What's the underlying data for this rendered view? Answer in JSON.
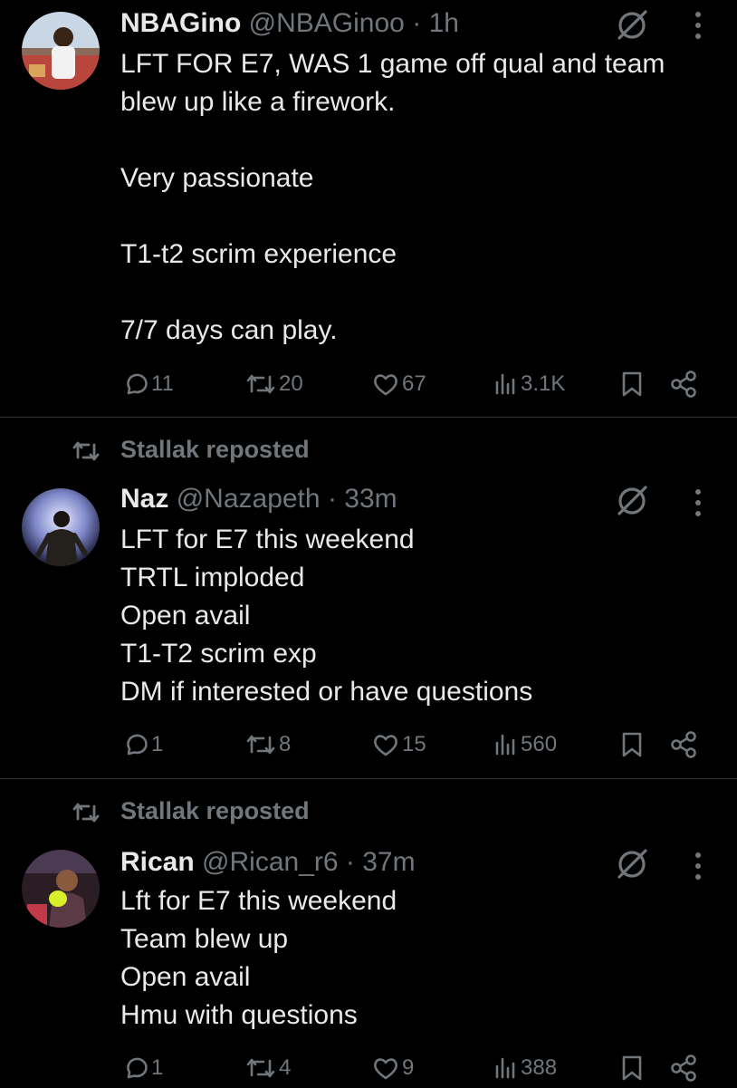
{
  "tweets": [
    {
      "name": "NBAGino",
      "handle": "@NBAGinoo",
      "sep": "·",
      "time": "1h",
      "lines": [
        "LFT FOR E7, WAS 1 game off qual and team",
        "blew up like a firework.",
        "",
        "Very passionate",
        "",
        "T1-t2 scrim experience",
        "",
        "7/7 days can play."
      ],
      "replies": "11",
      "reposts": "20",
      "likes": "67",
      "views": "3.1K"
    },
    {
      "reposted_by": "Stallak reposted",
      "name": "Naz",
      "handle": "@Nazapeth",
      "sep": "·",
      "time": "33m",
      "lines": [
        "LFT for E7 this weekend",
        "TRTL imploded",
        "Open avail",
        "T1-T2 scrim exp",
        "DM if interested or have questions"
      ],
      "replies": "1",
      "reposts": "8",
      "likes": "15",
      "views": "560"
    },
    {
      "reposted_by": "Stallak reposted",
      "name": "Rican",
      "handle": "@Rican_r6",
      "sep": "·",
      "time": "37m",
      "lines": [
        "Lft for E7 this weekend",
        "Team blew up",
        "Open avail",
        "Hmu with questions"
      ],
      "replies": "1",
      "reposts": "4",
      "likes": "9",
      "views": "388"
    }
  ],
  "icons": {
    "reply": "reply-icon",
    "repost": "repost-icon",
    "like": "heart-icon",
    "views": "views-icon",
    "bookmark": "bookmark-icon",
    "share": "share-icon",
    "grok": "grok-icon",
    "more": "more-icon"
  },
  "colors": {
    "background": "#000000",
    "text": "#e7e9ea",
    "muted": "#71767b",
    "divider": "#2f3336"
  }
}
